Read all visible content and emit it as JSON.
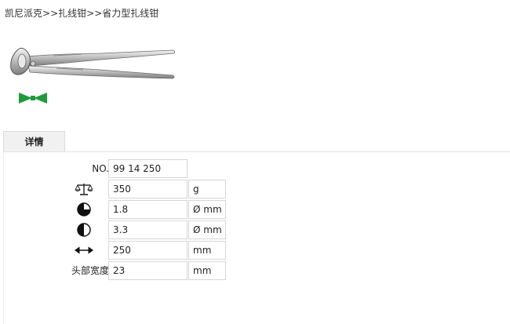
{
  "breadcrumb": {
    "items": [
      "凯尼派克",
      "扎线钳",
      "省力型扎线钳"
    ],
    "separator": ">>"
  },
  "tabs": [
    {
      "label": "详情",
      "active": true
    }
  ],
  "specs": {
    "no": {
      "label": "NO.",
      "value": "99 14 250"
    },
    "weight": {
      "icon": "scale-icon",
      "value": "350",
      "unit": "g"
    },
    "wire_soft": {
      "icon": "three-quarter-circle-icon",
      "value": "1.8",
      "unit": "Ø mm"
    },
    "wire_hard": {
      "icon": "half-circle-icon",
      "value": "3.3",
      "unit": "Ø mm"
    },
    "length": {
      "icon": "double-arrow-icon",
      "value": "250",
      "unit": "mm"
    },
    "head_width": {
      "label": "头部宽度",
      "value": "23",
      "unit": "mm"
    }
  },
  "colors": {
    "badge": "#1e9a3c",
    "tab_bg": "#f1f1f1",
    "border": "#d6d6d6"
  }
}
